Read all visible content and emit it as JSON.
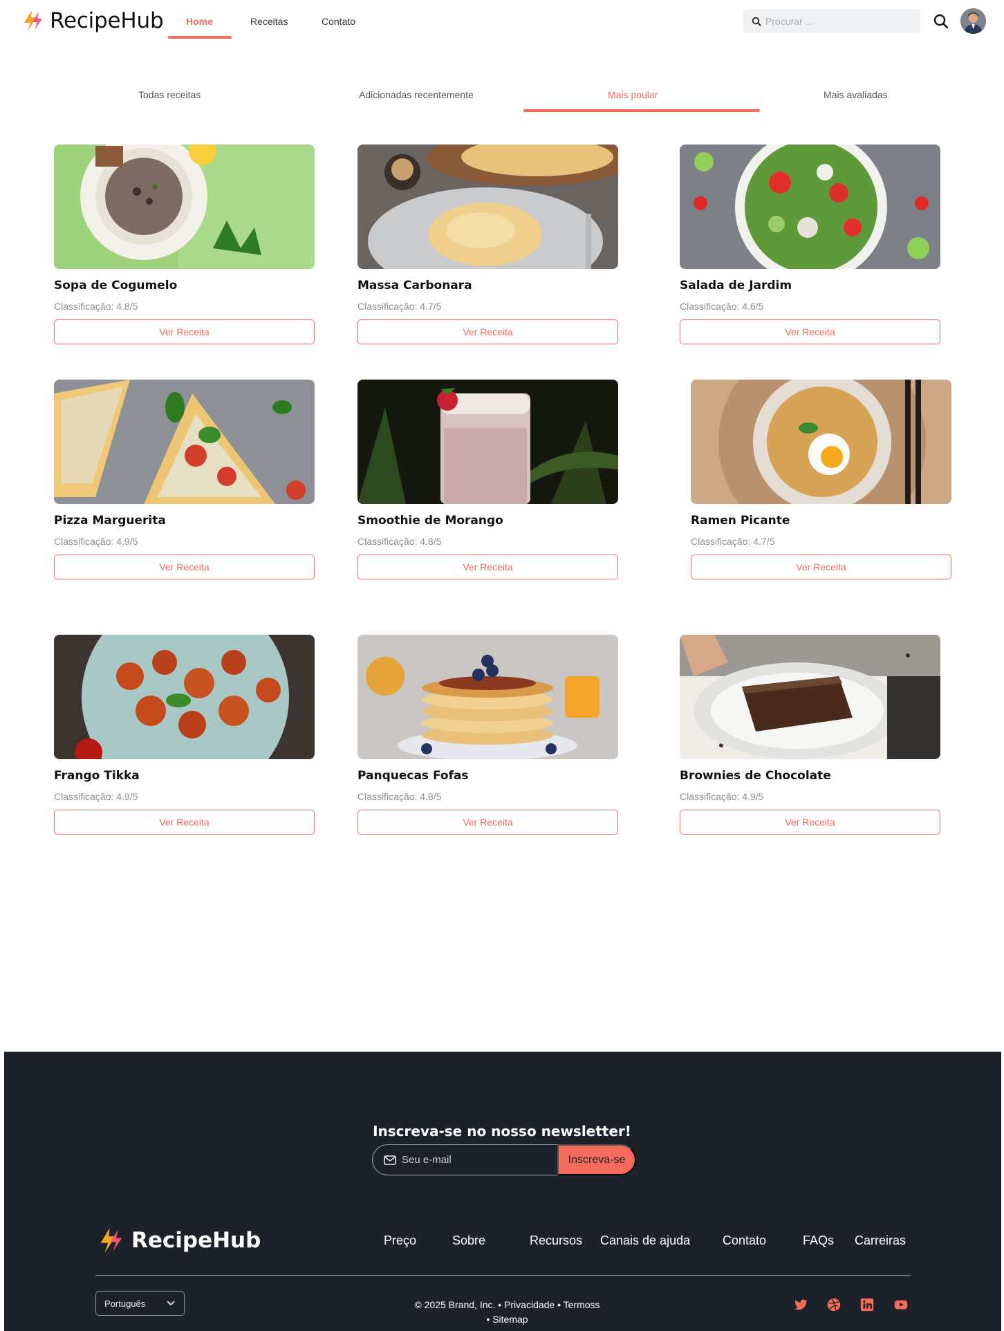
{
  "brand": {
    "name": "RecipeHub"
  },
  "nav": {
    "links": [
      {
        "label": "Home",
        "active": true
      },
      {
        "label": "Receitas",
        "active": false
      },
      {
        "label": "Contato",
        "active": false
      }
    ],
    "search_placeholder": "Procurar ..."
  },
  "tabs": [
    {
      "label": "Todas receitas",
      "active": false
    },
    {
      "label": "Adicionadas recentemente",
      "active": false
    },
    {
      "label": "Mais poular",
      "active": true
    },
    {
      "label": "Mais avaliadas",
      "active": false
    }
  ],
  "recipes": [
    {
      "title": "Sopa de Cogumelo",
      "rating": "Classificação: 4.8/5",
      "button": "Ver Receita"
    },
    {
      "title": "Massa Carbonara",
      "rating": "Classificação: 4.7/5",
      "button": "Ver Receita"
    },
    {
      "title": "Salada de Jardim",
      "rating": "Classificação: 4.6/5",
      "button": "Ver Receita"
    },
    {
      "title": "Pizza Marguerita",
      "rating": "Classificação: 4.9/5",
      "button": "Ver Receita"
    },
    {
      "title": "Smoothie de Morango",
      "rating": "Classificação: 4.8/5",
      "button": "Ver Receita"
    },
    {
      "title": "Ramen Picante",
      "rating": "Classificação: 4.7/5",
      "button": "Ver Receita"
    },
    {
      "title": "Frango Tikka",
      "rating": "Classificação: 4.9/5",
      "button": "Ver Receita"
    },
    {
      "title": "Panquecas Fofas",
      "rating": "Classificação: 4.8/5",
      "button": "Ver Receita"
    },
    {
      "title": "Brownies de Chocolate",
      "rating": "Classificação: 4.9/5",
      "button": "Ver Receita"
    }
  ],
  "footer": {
    "newsletter_title": "Inscreva-se no nosso newsletter!",
    "email_placeholder": "Seu e-mail",
    "subscribe_label": "Inscreva-se",
    "brand": "RecipeHub",
    "links": [
      "Preço",
      "Sobre",
      "Recursos",
      "Canais de ajuda",
      "Contato",
      "FAQs",
      "Carreiras"
    ],
    "language": "Português",
    "copyright_line1": "© 2025 Brand, Inc. • Privacidade • Termoss",
    "copyright_line2": "• Sitemap",
    "social": [
      "twitter-icon",
      "dribbble-icon",
      "linkedin-icon",
      "youtube-icon"
    ]
  },
  "colors": {
    "accent": "#f46b5b",
    "footer_bg": "#1d2129"
  }
}
